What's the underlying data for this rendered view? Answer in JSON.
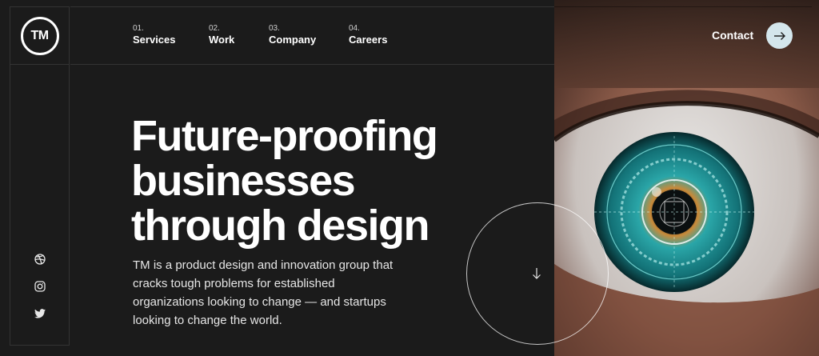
{
  "logo": {
    "text": "TM"
  },
  "nav": [
    {
      "num": "01.",
      "label": "Services"
    },
    {
      "num": "02.",
      "label": "Work"
    },
    {
      "num": "03.",
      "label": "Company"
    },
    {
      "num": "04.",
      "label": "Careers"
    }
  ],
  "contact": {
    "label": "Contact",
    "icon": "arrow-right-icon"
  },
  "hero": {
    "headline": [
      "Future-proofing",
      "businesses",
      "through design"
    ],
    "description": "TM is a product design and innovation group that cracks tough problems for established organizations looking to change — and startups looking to change the world."
  },
  "socials": [
    {
      "name": "dribbble-icon"
    },
    {
      "name": "instagram-icon"
    },
    {
      "name": "twitter-icon"
    }
  ],
  "scroll": {
    "icon": "arrow-down-icon"
  },
  "colors": {
    "background": "#1b1b1b",
    "contact_button": "#d4e6ec",
    "iris": "#2aa6a8"
  }
}
